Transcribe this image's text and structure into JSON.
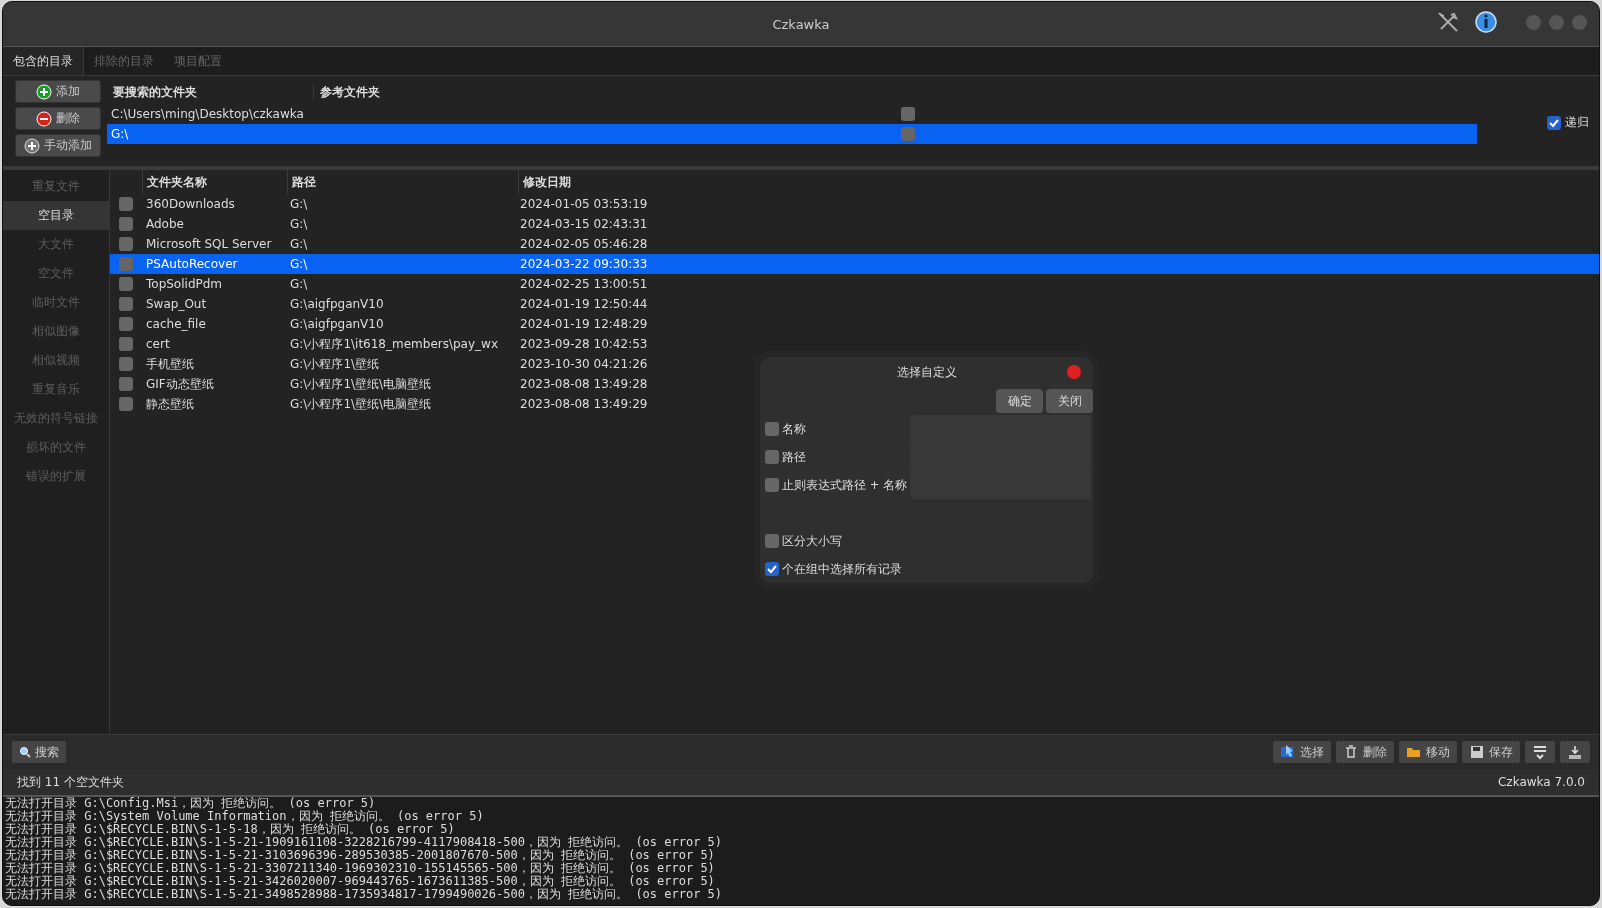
{
  "window": {
    "title": "Czkawka"
  },
  "tabs": [
    {
      "label": "包含的目录",
      "selected": true
    },
    {
      "label": "排除的目录",
      "selected": false
    },
    {
      "label": "项目配置",
      "selected": false
    }
  ],
  "directory_buttons": [
    {
      "label": "添加",
      "kind": "add"
    },
    {
      "label": "删除",
      "kind": "remove"
    },
    {
      "label": "手动添加",
      "kind": "manual"
    }
  ],
  "directories": {
    "columns": [
      "要搜索的文件夹",
      "参考文件夹"
    ],
    "rows": [
      {
        "path": "C:\\Users\\ming\\Desktop\\czkawka",
        "reference": false,
        "selected": false
      },
      {
        "path": "G:\\",
        "reference": false,
        "selected": true
      }
    ]
  },
  "recursive": {
    "label": "递归",
    "checked": true
  },
  "sidebar": {
    "items": [
      {
        "label": "重复文件",
        "selected": false
      },
      {
        "label": "空目录",
        "selected": true
      },
      {
        "label": "大文件",
        "selected": false
      },
      {
        "label": "空文件",
        "selected": false
      },
      {
        "label": "临时文件",
        "selected": false
      },
      {
        "label": "相似图像",
        "selected": false
      },
      {
        "label": "相似视频",
        "selected": false
      },
      {
        "label": "重复音乐",
        "selected": false
      },
      {
        "label": "无效的符号链接",
        "selected": false
      },
      {
        "label": "损坏的文件",
        "selected": false
      },
      {
        "label": "错误的扩展",
        "selected": false
      }
    ]
  },
  "table": {
    "columns": [
      "文件夹名称",
      "路径",
      "修改日期"
    ],
    "rows": [
      {
        "name": "360Downloads",
        "path": "G:\\",
        "modified": "2024-01-05 03:53:19",
        "checked": false,
        "selected": false
      },
      {
        "name": "Adobe",
        "path": "G:\\",
        "modified": "2024-03-15 02:43:31",
        "checked": false,
        "selected": false
      },
      {
        "name": "Microsoft SQL Server",
        "path": "G:\\",
        "modified": "2024-02-05 05:46:28",
        "checked": false,
        "selected": false
      },
      {
        "name": "PSAutoRecover",
        "path": "G:\\",
        "modified": "2024-03-22 09:30:33",
        "checked": false,
        "selected": true
      },
      {
        "name": "TopSolidPdm",
        "path": "G:\\",
        "modified": "2024-02-25 13:00:51",
        "checked": false,
        "selected": false
      },
      {
        "name": "Swap_Out",
        "path": "G:\\aigfpganV10",
        "modified": "2024-01-19 12:50:44",
        "checked": false,
        "selected": false
      },
      {
        "name": "cache_file",
        "path": "G:\\aigfpganV10",
        "modified": "2024-01-19 12:48:29",
        "checked": false,
        "selected": false
      },
      {
        "name": "cert",
        "path": "G:\\小程序1\\it618_members\\pay_wx",
        "modified": "2023-09-28 10:42:53",
        "checked": false,
        "selected": false
      },
      {
        "name": "手机壁纸",
        "path": "G:\\小程序1\\壁纸",
        "modified": "2023-10-30 04:21:26",
        "checked": false,
        "selected": false
      },
      {
        "name": "GIF动态壁纸",
        "path": "G:\\小程序1\\壁纸\\电脑壁纸",
        "modified": "2023-08-08 13:49:28",
        "checked": false,
        "selected": false
      },
      {
        "name": "静态壁纸",
        "path": "G:\\小程序1\\壁纸\\电脑壁纸",
        "modified": "2023-08-08 13:49:29",
        "checked": false,
        "selected": false
      }
    ]
  },
  "dialog": {
    "title": "选择自定义",
    "buttons": [
      "确定",
      "关闭"
    ],
    "options": [
      {
        "label": "名称",
        "checked": false,
        "kind": "field"
      },
      {
        "label": "路径",
        "checked": false,
        "kind": "field"
      },
      {
        "label": "止则表达式路径 + 名称",
        "checked": false,
        "kind": "field"
      },
      {
        "label": "区分大小写",
        "checked": false,
        "kind": "plain"
      },
      {
        "label": "个在组中选择所有记录",
        "checked": true,
        "kind": "plain"
      }
    ]
  },
  "search_button": {
    "label": "搜索"
  },
  "toolbar": [
    {
      "label": "选择",
      "kind": "select"
    },
    {
      "label": "删除",
      "kind": "delete"
    },
    {
      "label": "移动",
      "kind": "move"
    },
    {
      "label": "保存",
      "kind": "save"
    },
    {
      "kind": "sort"
    },
    {
      "kind": "hide"
    }
  ],
  "status_bar": {
    "message": "找到 11 个空文件夹",
    "version": "Czkawka 7.0.0"
  },
  "log": [
    "无法打开目录 G:\\Config.Msi，因为 拒绝访问。 (os error 5)",
    "无法打开目录 G:\\System Volume Information，因为 拒绝访问。 (os error 5)",
    "无法打开目录 G:\\$RECYCLE.BIN\\S-1-5-18，因为 拒绝访问。 (os error 5)",
    "无法打开目录 G:\\$RECYCLE.BIN\\S-1-5-21-1909161108-3228216799-4117908418-500，因为 拒绝访问。 (os error 5)",
    "无法打开目录 G:\\$RECYCLE.BIN\\S-1-5-21-3103696396-289530385-2001807670-500，因为 拒绝访问。 (os error 5)",
    "无法打开目录 G:\\$RECYCLE.BIN\\S-1-5-21-3307211340-1969302310-155145565-500，因为 拒绝访问。 (os error 5)",
    "无法打开目录 G:\\$RECYCLE.BIN\\S-1-5-21-3426020007-969443765-1673611385-500，因为 拒绝访问。 (os error 5)",
    "无法打开目录 G:\\$RECYCLE.BIN\\S-1-5-21-3498528988-1735934817-1799490026-500，因为 拒绝访问。 (os error 5)"
  ]
}
